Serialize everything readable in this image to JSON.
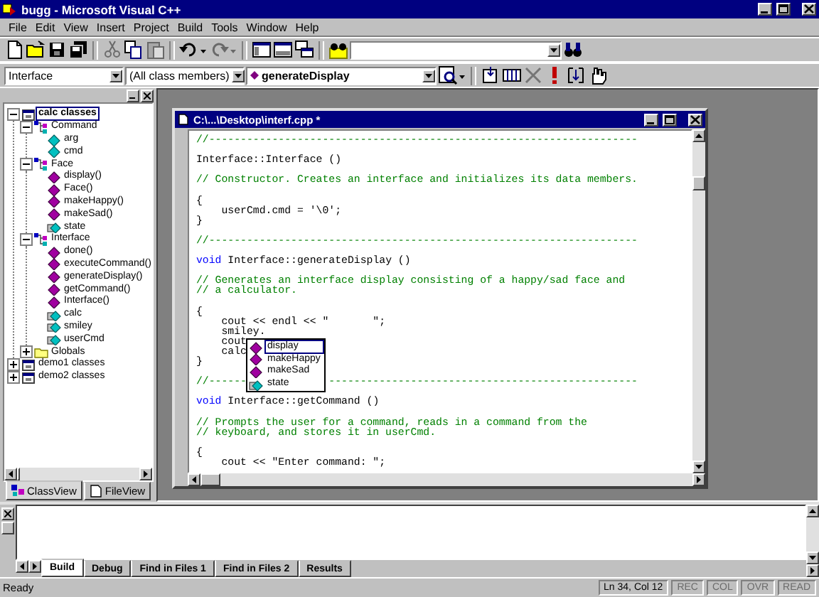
{
  "window": {
    "title": "bugg - Microsoft Visual C++"
  },
  "menu": [
    "File",
    "Edit",
    "View",
    "Insert",
    "Project",
    "Build",
    "Tools",
    "Window",
    "Help"
  ],
  "toolbar": [
    {
      "kind": "new",
      "disabled": false
    },
    {
      "kind": "open",
      "disabled": false
    },
    {
      "kind": "save",
      "disabled": false
    },
    {
      "kind": "save_all",
      "disabled": false
    },
    {
      "kind": "separator"
    },
    {
      "kind": "cut",
      "disabled": true
    },
    {
      "kind": "copy",
      "disabled": false
    },
    {
      "kind": "paste",
      "disabled": true
    },
    {
      "kind": "separator"
    },
    {
      "kind": "undo",
      "disabled": false
    },
    {
      "kind": "redo",
      "disabled": true
    },
    {
      "kind": "separator"
    },
    {
      "kind": "workspace",
      "disabled": false
    },
    {
      "kind": "output",
      "disabled": false
    },
    {
      "kind": "window_list",
      "disabled": false
    },
    {
      "kind": "separator"
    },
    {
      "kind": "find_in_files",
      "disabled": false
    },
    {
      "kind": "combo"
    },
    {
      "kind": "find",
      "disabled": false
    }
  ],
  "wizard_bar": {
    "combos": [
      {
        "value": "Interface",
        "kind": "plain"
      },
      {
        "value": "(All class members)",
        "kind": "plain"
      },
      {
        "value": "generateDisplay",
        "kind": "member"
      }
    ],
    "tools": [
      {
        "kind": "wizard",
        "disabled": false
      },
      {
        "kind": "separator"
      },
      {
        "kind": "compile",
        "disabled": false
      },
      {
        "kind": "build",
        "disabled": false
      },
      {
        "kind": "stop",
        "disabled": true
      },
      {
        "kind": "execute",
        "disabled": false
      },
      {
        "kind": "step",
        "disabled": false
      },
      {
        "kind": "breakpoint",
        "disabled": false
      }
    ]
  },
  "class_view": {
    "tree": [
      {
        "label": "calc classes",
        "kind": "project",
        "expanded": true,
        "selected": true,
        "children": [
          {
            "label": "Command",
            "kind": "class",
            "expanded": true,
            "selected": false,
            "children": [
              {
                "label": "arg",
                "kind": "field",
                "selected": false
              },
              {
                "label": "cmd",
                "kind": "field",
                "selected": false
              }
            ]
          },
          {
            "label": "Face",
            "kind": "class",
            "expanded": true,
            "selected": false,
            "children": [
              {
                "label": "display()",
                "kind": "method",
                "selected": false
              },
              {
                "label": "Face()",
                "kind": "method",
                "selected": false
              },
              {
                "label": "makeHappy()",
                "kind": "method",
                "selected": false
              },
              {
                "label": "makeSad()",
                "kind": "method",
                "selected": false
              },
              {
                "label": "state",
                "kind": "object",
                "selected": false
              }
            ]
          },
          {
            "label": "Interface",
            "kind": "class",
            "expanded": true,
            "selected": false,
            "children": [
              {
                "label": "done()",
                "kind": "method",
                "selected": false
              },
              {
                "label": "executeCommand()",
                "kind": "method",
                "selected": false
              },
              {
                "label": "generateDisplay()",
                "kind": "method",
                "selected": false
              },
              {
                "label": "getCommand()",
                "kind": "method",
                "selected": false
              },
              {
                "label": "Interface()",
                "kind": "method",
                "selected": false
              },
              {
                "label": "calc",
                "kind": "object",
                "selected": false
              },
              {
                "label": "smiley",
                "kind": "object",
                "selected": false
              },
              {
                "label": "userCmd",
                "kind": "object",
                "selected": false
              }
            ]
          },
          {
            "label": "Globals",
            "kind": "folder",
            "expanded": false,
            "selected": false
          }
        ]
      },
      {
        "label": "demo1 classes",
        "kind": "project",
        "expanded": false,
        "selected": false
      },
      {
        "label": "demo2 classes",
        "kind": "project",
        "expanded": false,
        "selected": false
      }
    ],
    "tabs": [
      {
        "label": "ClassView",
        "kind": "classes",
        "selected": true
      },
      {
        "label": "FileView",
        "kind": "files",
        "selected": false
      }
    ]
  },
  "editor": {
    "title": "C:\\...\\Desktop\\interf.cpp *",
    "lines": [
      {
        "kind": "comment",
        "text": "//--------------------------------------------------------------------"
      },
      {
        "kind": "blank"
      },
      {
        "kind": "code",
        "text": "Interface::Interface ()"
      },
      {
        "kind": "blank"
      },
      {
        "kind": "comment",
        "text": "// Constructor. Creates an interface and initializes its data members."
      },
      {
        "kind": "blank"
      },
      {
        "kind": "code",
        "text": "{"
      },
      {
        "kind": "code",
        "text": "    userCmd.cmd = '\\0';"
      },
      {
        "kind": "code",
        "text": "}"
      },
      {
        "kind": "blank"
      },
      {
        "kind": "comment",
        "text": "//--------------------------------------------------------------------"
      },
      {
        "kind": "blank"
      },
      {
        "kind": "declaration",
        "keyword": "void",
        "text": " Interface::generateDisplay ()"
      },
      {
        "kind": "blank"
      },
      {
        "kind": "comment",
        "text": "// Generates an interface display consisting of a happy/sad face and"
      },
      {
        "kind": "comment",
        "text": "// a calculator."
      },
      {
        "kind": "blank"
      },
      {
        "kind": "code",
        "text": "{"
      },
      {
        "kind": "code",
        "text": "    cout << endl << \"       \";"
      },
      {
        "kind": "code",
        "text": "    smiley."
      },
      {
        "kind": "code",
        "text": "    cout"
      },
      {
        "kind": "code",
        "text": "    calc"
      },
      {
        "kind": "code",
        "text": "}"
      },
      {
        "kind": "blank"
      },
      {
        "kind": "covered_comment",
        "parts": [
          "//------",
          "-------------------------------------------------"
        ]
      },
      {
        "kind": "blank"
      },
      {
        "kind": "declaration",
        "keyword": "void",
        "text": " Interface::getCommand ()"
      },
      {
        "kind": "blank"
      },
      {
        "kind": "comment",
        "text": "// Prompts the user for a command, reads in a command from the"
      },
      {
        "kind": "comment",
        "text": "// keyboard, and stores it in userCmd."
      },
      {
        "kind": "blank"
      },
      {
        "kind": "code",
        "text": "{"
      },
      {
        "kind": "code",
        "text": "    cout << \"Enter command: \";"
      }
    ],
    "completion": [
      {
        "label": "display",
        "kind": "method",
        "selected": true
      },
      {
        "label": "makeHappy",
        "kind": "method",
        "selected": false
      },
      {
        "label": "makeSad",
        "kind": "method",
        "selected": false
      },
      {
        "label": "state",
        "kind": "object",
        "selected": false
      }
    ]
  },
  "output": {
    "tabs": [
      {
        "label": "Build",
        "selected": true
      },
      {
        "label": "Debug",
        "selected": false
      },
      {
        "label": "Find in Files 1",
        "selected": false
      },
      {
        "label": "Find in Files 2",
        "selected": false
      },
      {
        "label": "Results",
        "selected": false
      }
    ]
  },
  "status_bar": {
    "message": "Ready",
    "position": "Ln 34, Col 12",
    "indicators": [
      {
        "label": "REC",
        "active": false
      },
      {
        "label": "COL",
        "active": false
      },
      {
        "label": "OVR",
        "active": false
      },
      {
        "label": "READ",
        "active": false
      }
    ]
  }
}
